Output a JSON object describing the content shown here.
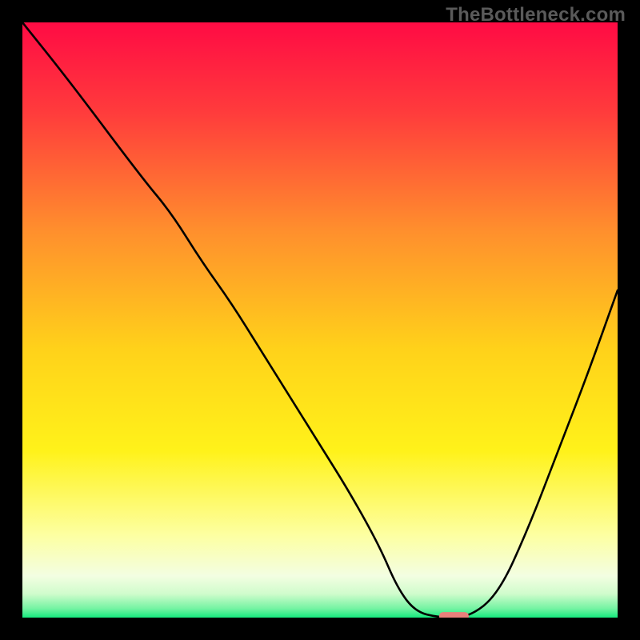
{
  "watermark": "TheBottleneck.com",
  "chart_data": {
    "type": "line",
    "title": "",
    "xlabel": "",
    "ylabel": "",
    "xlim": [
      0,
      100
    ],
    "ylim": [
      0,
      100
    ],
    "grid": false,
    "legend": false,
    "background_gradient": {
      "stops": [
        {
          "pos": 0.0,
          "color": "#ff0b44"
        },
        {
          "pos": 0.15,
          "color": "#ff3b3c"
        },
        {
          "pos": 0.35,
          "color": "#ff8f2d"
        },
        {
          "pos": 0.55,
          "color": "#ffd21a"
        },
        {
          "pos": 0.72,
          "color": "#fff21a"
        },
        {
          "pos": 0.86,
          "color": "#fdffa0"
        },
        {
          "pos": 0.93,
          "color": "#f3fee2"
        },
        {
          "pos": 0.96,
          "color": "#d0fccc"
        },
        {
          "pos": 0.985,
          "color": "#73f3a2"
        },
        {
          "pos": 1.0,
          "color": "#15ea7e"
        }
      ]
    },
    "series": [
      {
        "name": "bottleneck-curve",
        "color": "#000000",
        "x": [
          0,
          8,
          20,
          25,
          30,
          35,
          40,
          45,
          50,
          55,
          60,
          63,
          66,
          70,
          75,
          80,
          85,
          90,
          95,
          100
        ],
        "y": [
          100,
          90,
          74,
          68,
          60,
          53,
          45,
          37,
          29,
          21,
          12,
          5,
          1,
          0,
          0,
          4,
          15,
          28,
          41,
          55
        ]
      }
    ],
    "marker": {
      "name": "optimal-marker",
      "x": 72.5,
      "y": 0,
      "width_pct": 5,
      "height_pct": 1.3,
      "color": "#e97f7b"
    }
  }
}
